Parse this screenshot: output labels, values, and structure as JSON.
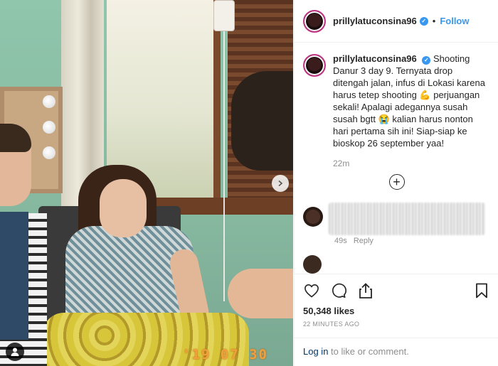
{
  "post": {
    "username": "prillylatuconsina96",
    "verified_badge": "✓",
    "separator": "•",
    "follow_label": "Follow"
  },
  "photo": {
    "date_stamp": "'19 07 30"
  },
  "caption": {
    "username": "prillylatuconsina96",
    "text": "Shooting Danur 3 day 9. Ternyata drop ditengah jalan, infus di Lokasi karena harus tetep shooting 💪 perjuangan sekali! Apalagi adegannya susah susah bgtt 😭 kalian harus nonton hari pertama sih ini! Siap-siap ke bioskop 26 september yaa!",
    "time": "22m"
  },
  "load_more_label": "+",
  "comment": {
    "time": "49s",
    "reply_label": "Reply"
  },
  "likes": "50,348 likes",
  "timestamp": "22 MINUTES AGO",
  "login": {
    "link_label": "Log in",
    "rest": " to like or comment."
  },
  "icons": [
    "heart-icon",
    "comment-icon",
    "share-icon",
    "bookmark-icon",
    "user-tag-icon",
    "chevron-right-icon"
  ],
  "colors": {
    "link": "#3897f0",
    "muted": "#8e8e8e",
    "login_link": "#003569",
    "stamp": "#f2a13a"
  }
}
